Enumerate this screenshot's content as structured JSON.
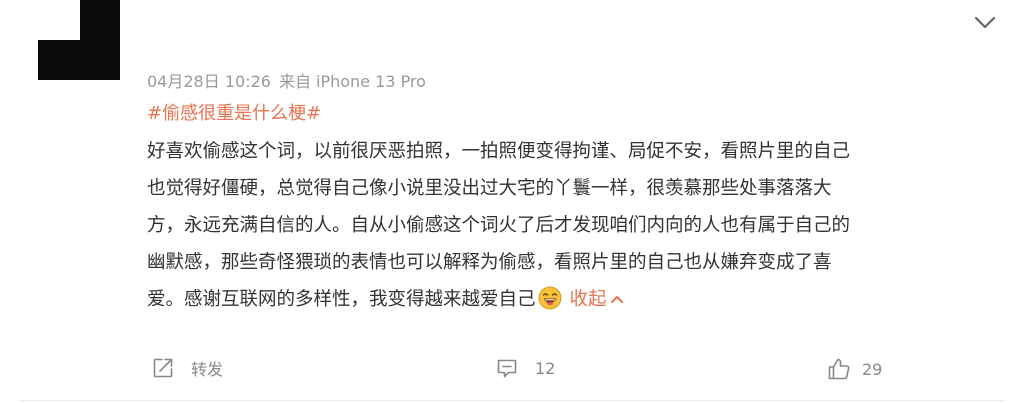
{
  "post": {
    "meta": {
      "date": "04月28日",
      "time": "10:26",
      "source": "来自 iPhone 13 Pro"
    },
    "topic": "#偷感很重是什么梗#",
    "content_lines": [
      "好喜欢偷感这个词，以前很厌恶拍照，一拍照便变得拘谨、局促不安，看照片里的自己",
      "也觉得好僵硬，总觉得自己像小说里没出过大宅的丫鬟一样，很羡慕那些处事落落大",
      "方，永远充满自信的人。自从小偷感这个词火了后才发现咱们内向的人也有属于自己的",
      "幽默感，那些奇怪猥琐的表情也可以解释为偷感，看照片里的自己也从嫌弃变成了喜",
      "爱。感谢互联网的多样性，我变得越来越爱自己"
    ],
    "collapse_label": "收起",
    "collapse_icon": "chevron-up-icon",
    "emoji": "laughing-face-emoji",
    "more_icon": "chevron-down-icon"
  },
  "actions": {
    "repost": {
      "label": "转发",
      "icon": "share-icon"
    },
    "comment": {
      "count": "12",
      "icon": "comment-icon"
    },
    "like": {
      "count": "29",
      "icon": "thumbs-up-icon"
    }
  },
  "colors": {
    "accent": "#eb7350",
    "text": "#333333",
    "muted": "#999999",
    "action": "#888888"
  }
}
